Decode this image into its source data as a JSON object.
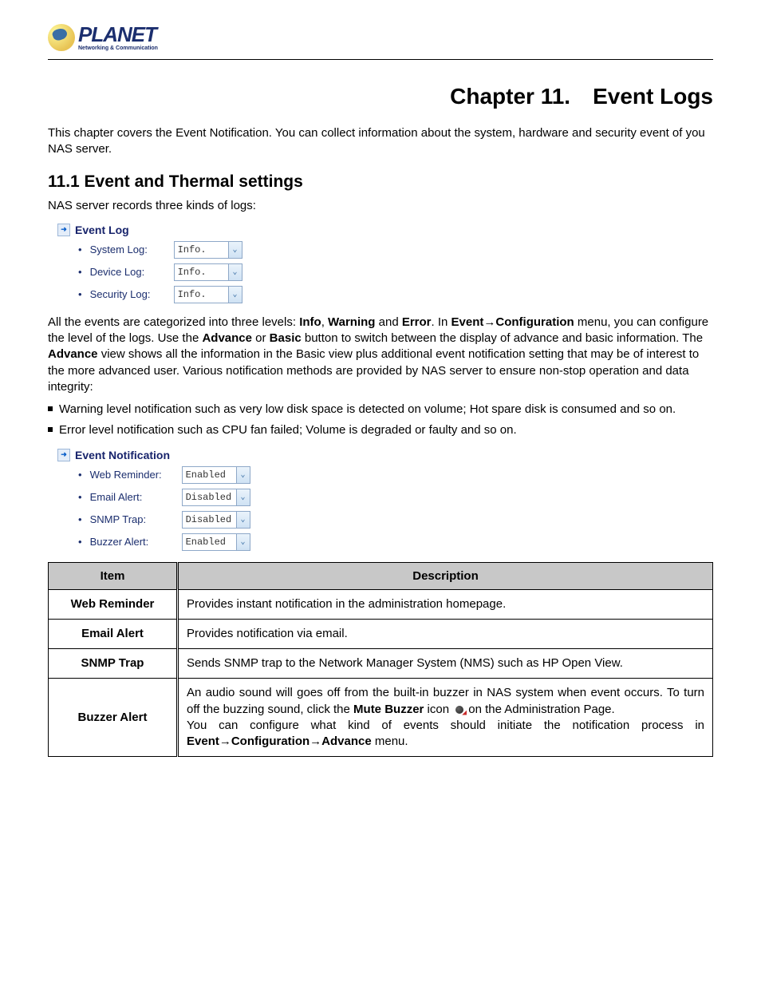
{
  "logo": {
    "main": "PLANET",
    "sub": "Networking & Communication"
  },
  "chapter": {
    "prefix": "Chapter 11.",
    "title": "Event Logs"
  },
  "intro": "This chapter covers the Event Notification. You can collect information about the system, hardware and security event of you NAS server.",
  "section_11_1": {
    "title": "11.1 Event and Thermal settings",
    "intro": "NAS server records three kinds of logs:"
  },
  "event_log_panel": {
    "title": "Event Log",
    "items": [
      {
        "label": "System Log:",
        "value": "Info."
      },
      {
        "label": "Device Log:",
        "value": "Info."
      },
      {
        "label": "Security Log:",
        "value": "Info."
      }
    ]
  },
  "para2": {
    "t1": "All the events are categorized into three levels: ",
    "b1": "Info",
    "c1": ", ",
    "b2": "Warning",
    "c2": " and ",
    "b3": "Error",
    "c3": ". In ",
    "b4": "Event→Configuration",
    "t2": " menu, you can configure the level of the logs. Use the ",
    "b5": "Advance",
    "c4": " or ",
    "b6": "Basic",
    "t3": " button to switch between the display of advance and basic information. The ",
    "b7": "Advance",
    "t4": " view shows all the information in the Basic view plus additional event notification setting that may be of interest to the more advanced user. Various notification methods are provided by NAS server to ensure non-stop operation and data integrity:"
  },
  "bullets": [
    "Warning level notification such as very low disk space is detected on volume; Hot spare disk is consumed and so on.",
    "Error level notification such as CPU fan failed; Volume is degraded or faulty and so on."
  ],
  "event_notif_panel": {
    "title": "Event Notification",
    "items": [
      {
        "label": "Web Reminder:",
        "value": "Enabled"
      },
      {
        "label": "Email Alert:",
        "value": "Disabled"
      },
      {
        "label": "SNMP Trap:",
        "value": "Disabled"
      },
      {
        "label": "Buzzer Alert:",
        "value": "Enabled"
      }
    ]
  },
  "table": {
    "headers": [
      "Item",
      "Description"
    ],
    "rows": [
      {
        "item": "Web Reminder",
        "desc": "Provides instant notification in the administration homepage."
      },
      {
        "item": "Email Alert",
        "desc": "Provides notification via email."
      },
      {
        "item": "SNMP Trap",
        "desc": "Sends SNMP trap to the Network Manager System (NMS) such as HP Open View."
      },
      {
        "item": "Buzzer Alert",
        "desc_parts": {
          "t1": "An audio sound will goes off from the built-in buzzer in NAS system when event occurs. To turn off the buzzing sound, click the ",
          "b1": "Mute Buzzer",
          "t2": " icon ",
          "t3": "on the Administration Page.",
          "t4": "You can configure what kind of events should initiate the notification process in ",
          "b2": "Event→Configuration→Advance",
          "t5": " menu."
        }
      }
    ]
  }
}
